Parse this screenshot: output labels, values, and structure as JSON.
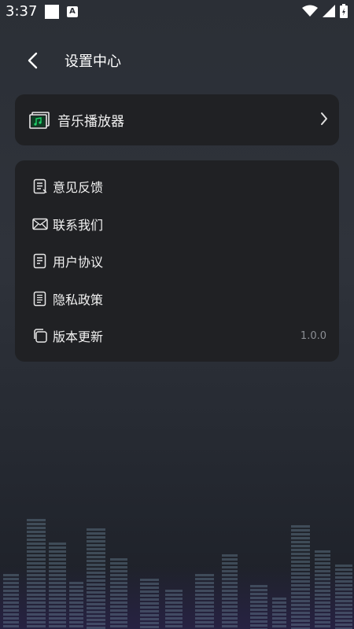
{
  "status_bar": {
    "time": "3:37",
    "badge_letter": "A"
  },
  "header": {
    "title": "设置中心"
  },
  "player_card": {
    "label": "音乐播放器",
    "accent": "#1fd36b"
  },
  "menu": {
    "items": [
      {
        "label": "意见反馈",
        "icon": "feedback-icon"
      },
      {
        "label": "联系我们",
        "icon": "mail-icon"
      },
      {
        "label": "用户协议",
        "icon": "document-icon"
      },
      {
        "label": "隐私政策",
        "icon": "policy-icon"
      },
      {
        "label": "版本更新",
        "icon": "layers-icon",
        "value": "1.0.0"
      }
    ]
  },
  "colors": {
    "background": "#2b2f36",
    "card": "#202124",
    "text": "#f2f2f2",
    "muted": "#8c8f95"
  }
}
